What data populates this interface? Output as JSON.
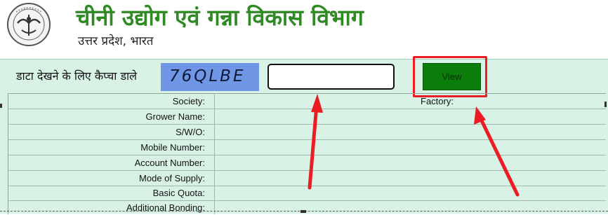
{
  "header": {
    "title": "चीनी उद्योग एवं गन्ना विकास विभाग",
    "subtitle": "उत्तर प्रदेश, भारत"
  },
  "captcha": {
    "label": "डाटा देखने के लिए कैप्चा डाले",
    "code": "76QLBE",
    "input_value": "",
    "button_label": "View"
  },
  "details": {
    "factory_label": "Factory:",
    "rows": [
      {
        "label": "Society:",
        "value": ""
      },
      {
        "label": "Grower Name:",
        "value": ""
      },
      {
        "label": "S/W/O:",
        "value": ""
      },
      {
        "label": "Mobile Number:",
        "value": ""
      },
      {
        "label": "Account Number:",
        "value": ""
      },
      {
        "label": "Mode of Supply:",
        "value": ""
      },
      {
        "label": "Basic Quota:",
        "value": ""
      },
      {
        "label": "Additional Bonding:",
        "value": ""
      }
    ]
  },
  "annotations": {
    "color": "#ec1c24",
    "highlight": "view-button",
    "arrows": [
      "pointing to captcha input",
      "pointing to view button"
    ]
  },
  "colors": {
    "title_green": "#2f8a24",
    "band_bg": "#d8f3e6",
    "captcha_bg": "#6f97e6",
    "button_green": "#0b7d0b"
  }
}
